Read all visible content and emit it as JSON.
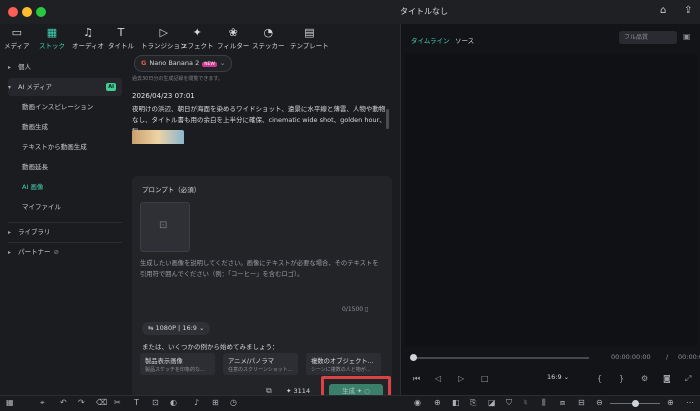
{
  "window": {
    "title": "タイトルなし",
    "traffic_colors": [
      "#ff5f57",
      "#febc2e",
      "#28c840"
    ]
  },
  "toolbar": {
    "items": [
      {
        "label": "メディア",
        "icon": "media-icon"
      },
      {
        "label": "ストック",
        "icon": "stock-icon"
      },
      {
        "label": "オーディオ",
        "icon": "audio-icon"
      },
      {
        "label": "タイトル",
        "icon": "title-icon"
      },
      {
        "label": "トランジション",
        "icon": "transition-icon"
      },
      {
        "label": "エフェクト",
        "icon": "effect-icon"
      },
      {
        "label": "フィルター",
        "icon": "filter-icon"
      },
      {
        "label": "ステッカー",
        "icon": "sticker-icon"
      },
      {
        "label": "テンプレート",
        "icon": "template-icon"
      }
    ],
    "active": "ストック"
  },
  "sidebar": {
    "items": [
      {
        "label": "個人",
        "type": "group"
      },
      {
        "label": "AI メディア",
        "type": "group",
        "badge": "AI"
      },
      {
        "label": "動画インスピレーション",
        "type": "sub"
      },
      {
        "label": "動画生成",
        "type": "sub"
      },
      {
        "label": "テキストから動画生成",
        "type": "sub"
      },
      {
        "label": "動画延長",
        "type": "sub"
      },
      {
        "label": "AI 画像",
        "type": "sub",
        "selected": true
      },
      {
        "label": "マイファイル",
        "type": "sub"
      },
      {
        "label": "ライブラリ",
        "type": "group"
      },
      {
        "label": "パートナー",
        "type": "group"
      }
    ]
  },
  "content": {
    "model": {
      "name": "Nano Banana 2",
      "badge": "NEW"
    },
    "history_note": "過去30日分の生成記録を閲覧できます。",
    "entry": {
      "date": "2026/04/23 07:01",
      "description": "夜明けの浜辺、朝日が海面を染めるワイドショット、遠景に水平線と薄雲、人物や動物なし、タイトル書も用の余白を上半分に確保、cinematic wide shot、golden hour、fil..."
    },
    "prompt": {
      "label": "プロンプト（必須）",
      "placeholder": "生成したい画像を説明してください。画像にテキストが必要な場合、そのテキストを引用符で囲んでください（例：「コーヒー」を含むロゴ）。",
      "counter": "0/1500"
    },
    "resolution": "1080P  |  16:9",
    "examples_label": "または、いくつかの例から始めてみましょう：",
    "examples": [
      {
        "title": "製品表示画像",
        "subtitle": "製品スケッチを印象的な..."
      },
      {
        "title": "アニメ/パノラマ",
        "subtitle": "任意のスクリーンショット..."
      },
      {
        "title": "複数のオブジェクト...",
        "subtitle": "シーンに複数の人と物が..."
      }
    ],
    "credits": "3114",
    "generate_label": "生成",
    "highlight_color": "#d94343"
  },
  "right": {
    "tabs": [
      "タイムライン",
      "ソース"
    ],
    "quality": "フル品質",
    "timecode": "00:00:00:00",
    "separator": "/",
    "aspect": "16:9"
  },
  "colors": {
    "accent": "#41d2b2",
    "background": "#151619"
  }
}
